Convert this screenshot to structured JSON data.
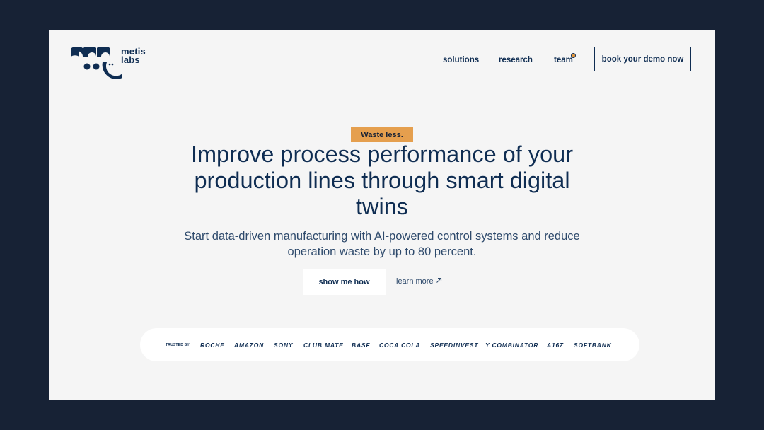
{
  "header": {
    "logo_line1": "metis",
    "logo_line2": "labs",
    "nav": [
      {
        "label": "solutions"
      },
      {
        "label": "research"
      },
      {
        "label": "team"
      }
    ],
    "cta_label": "book your demo now"
  },
  "hero": {
    "badge": "Waste less.",
    "headline": "Improve process performance of your production lines through smart digital twins",
    "subline": "Start data-driven manufacturing with AI-powered control systems and reduce operation waste by up to 80 percent.",
    "primary_button": "show me how",
    "secondary_link": "learn more",
    "secondary_link_icon": "arrow-up-right-icon"
  },
  "trusted": {
    "label": "TRUSTED BY",
    "brands": [
      "ROCHE",
      "AMAZON",
      "SONY",
      "CLUB MATE",
      "BASF",
      "COCA COLA",
      "SPEEDINVEST",
      "Y COMBINATOR",
      "A16Z",
      "SOFTBANK"
    ]
  },
  "colors": {
    "background": "#172235",
    "panel": "#f5f5f5",
    "primary": "#0f2d52",
    "accent": "#e59f4e"
  }
}
